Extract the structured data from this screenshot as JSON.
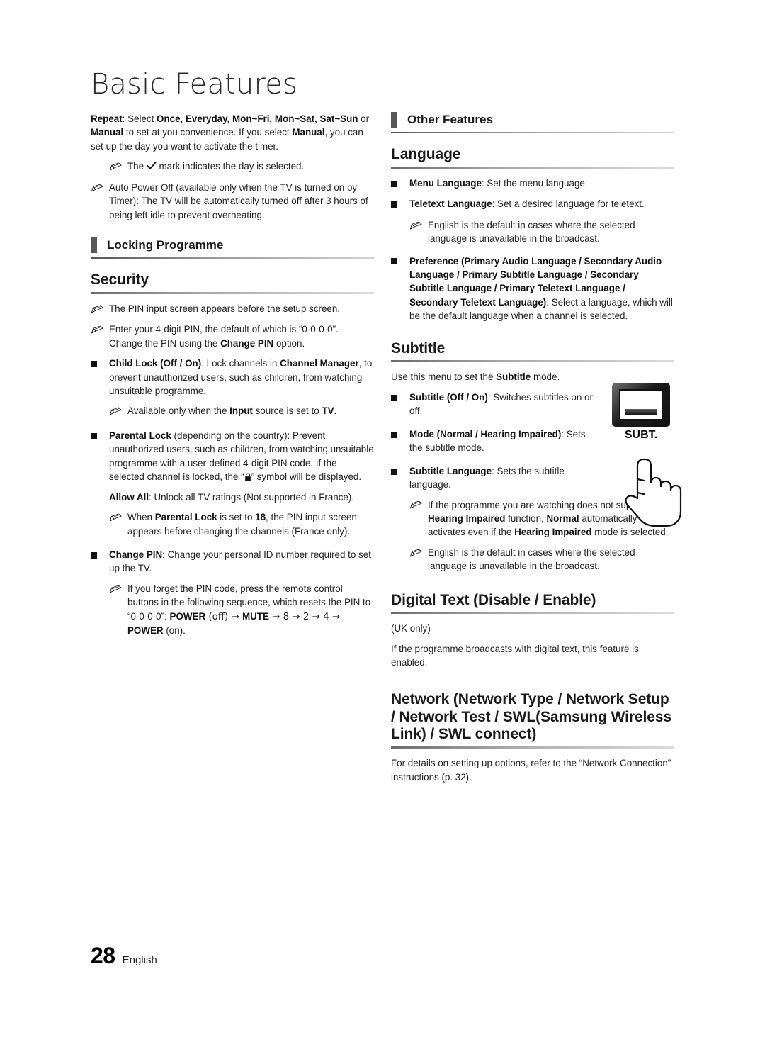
{
  "page": {
    "title": "Basic Features",
    "number": "28",
    "language": "English"
  },
  "icons": {
    "note": "pencil-note-icon",
    "bullet": "square-bullet-icon",
    "check": "check-mark-icon",
    "lock": "padlock-icon",
    "remote_button": "subt-remote-button-icon",
    "hand": "pointing-hand-icon"
  },
  "left_column": {
    "repeat_note": {
      "label": "Repeat",
      "text_1": ": Select ",
      "bold_1": "Once, Everyday, Mon~Fri, Mon~Sat, Sat~Sun",
      "text_2": " or ",
      "bold_2": "Manual",
      "text_3": " to set at you convenience. If you select ",
      "bold_3": "Manual",
      "text_4": ", you can set up the day you want to activate the timer."
    },
    "check_note": {
      "text_1": "The ",
      "text_2": " mark indicates the day is selected."
    },
    "auto_power_off_note": "Auto Power Off (available only when the TV is turned on by Timer): The TV will be automatically turned off after 3 hours of being left idle to prevent overheating.",
    "section_locking_programme": "Locking Programme",
    "heading_security": "Security",
    "security_notes": [
      "The PIN input screen appears before the setup screen."
    ],
    "pin_note": {
      "text_1": "Enter your 4-digit PIN, the default of which is “0-0-0-0”. Change the PIN using the ",
      "bold_1": "Change PIN",
      "text_2": " option."
    },
    "child_lock": {
      "bold_1": "Child Lock (Off / On)",
      "text_1": ": Lock channels in ",
      "bold_2": "Channel Manager",
      "text_2": ", to prevent unauthorized users, such as children, from watching unsuitable programme.",
      "note": {
        "text_1": "Available only when the ",
        "bold_1": "Input",
        "text_2": " source is set to ",
        "bold_2": "TV",
        "text_3": "."
      }
    },
    "parental_lock": {
      "bold_1": "Parental Lock",
      "text_1": " (depending on the country): Prevent unauthorized users, such as children, from watching unsuitable programme with a user-defined 4-digit PIN code. If the selected channel is locked, the “",
      "text_2": "” symbol will be displayed.",
      "allow_all": {
        "bold_1": "Allow All",
        "text_1": ": Unlock all TV ratings (Not supported in France)."
      },
      "note": {
        "text_1": "When ",
        "bold_1": "Parental Lock",
        "text_2": " is set to ",
        "bold_2": "18",
        "text_3": ", the PIN input screen appears before changing the channels (France only)."
      }
    },
    "change_pin": {
      "bold_1": "Change PIN",
      "text_1": ": Change your personal ID number required to set up the TV.",
      "note": {
        "text_1": "If you forget the PIN code, press the remote control buttons in the following sequence, which resets the PIN to “0-0-0-0”: ",
        "bold_1": "POWER",
        "text_2": " (off) → ",
        "bold_2": "MUTE",
        "text_3": " → 8 → 2 → 4 → ",
        "bold_3": "POWER",
        "text_4": " (on)."
      }
    }
  },
  "right_column": {
    "section_other_features": "Other Features",
    "heading_language": "Language",
    "menu_language": {
      "bold_1": "Menu Language",
      "text_1": ": Set the menu language."
    },
    "teletext_language": {
      "bold_1": "Teletext Language",
      "text_1": ": Set a desired language for teletext.",
      "note": "English is the default in cases where the selected language is unavailable in the broadcast."
    },
    "preference": {
      "bold_1": "Preference (Primary Audio Language / Secondary Audio Language / Primary Subtitle Language / Secondary Subtitle Language / Primary Teletext Language / Secondary Teletext Language)",
      "text_1": ": Select a language, which will be the default language when a channel is selected."
    },
    "heading_subtitle": "Subtitle",
    "subtitle_intro": {
      "text_1": "Use this menu to set the ",
      "bold_1": "Subtitle",
      "text_2": " mode."
    },
    "subtitle_onoff": {
      "bold_1": "Subtitle (Off / On)",
      "text_1": ": Switches subtitles on or off."
    },
    "subtitle_mode": {
      "bold_1": "Mode (Normal / Hearing Impaired)",
      "text_1": ": Sets the subtitle mode."
    },
    "subtitle_language": {
      "bold_1": "Subtitle Language",
      "text_1": ": Sets the subtitle language."
    },
    "hearing_note": {
      "text_1": "If the programme you are watching does not support the ",
      "bold_1": "Hearing Impaired",
      "text_2": " function, ",
      "bold_2": "Normal",
      "text_3": " automatically activates even if the ",
      "bold_3": "Hearing Impaired",
      "text_4": " mode is selected."
    },
    "english_default_note": "English is the default in cases where the selected language is unavailable in the broadcast.",
    "heading_digital_text": "Digital Text (Disable / Enable)",
    "digital_text_uk": "(UK only)",
    "digital_text_body": "If the programme broadcasts with digital text, this feature is enabled.",
    "heading_network": "Network (Network Type / Network Setup / Network Test / SWL(Samsung Wireless Link) / SWL connect)",
    "network_body": "For details on setting up options, refer to the “Network Connection” instructions (p. 32).",
    "remote_button_label": "SUBT."
  }
}
